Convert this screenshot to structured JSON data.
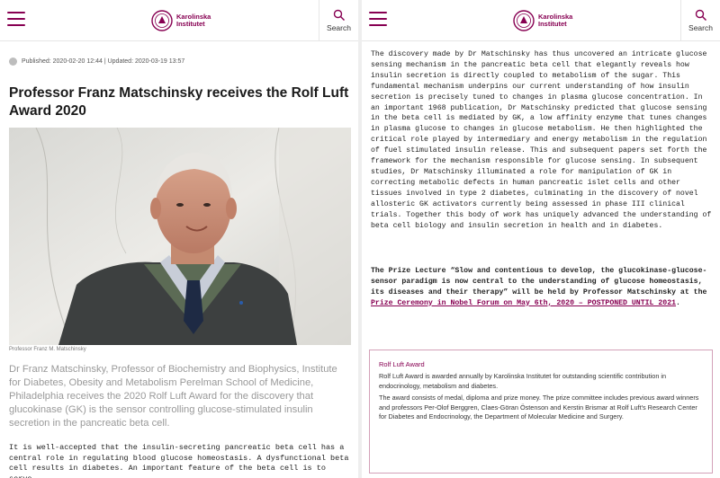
{
  "header": {
    "logo_line1": "Karolinska",
    "logo_line2": "Institutet",
    "search_label": "Search"
  },
  "article": {
    "meta": "Published: 2020-02-20 12:44 | Updated: 2020-03-19 13:57",
    "title": "Professor Franz Matschinsky receives the Rolf Luft Award 2020",
    "photo_caption": "Professor Franz M. Matschinsky",
    "lead": "Dr Franz Matschinsky, Professor of Biochemistry and Biophysics, Institute for Diabetes, Obesity and Metabolism Perelman School of Medicine, Philadelphia receives the 2020 Rolf Luft Award for the discovery that glucokinase (GK) is the sensor controlling glucose-stimulated insulin secretion in the pancreatic beta cell.",
    "body_intro": "It is well-accepted that the insulin-secreting pancreatic beta cell has a central role in regulating blood glucose homeostasis. A dysfunctional beta cell results in diabetes. An important feature of the beta cell is to serve"
  },
  "continued": {
    "body": "The discovery made by Dr Matschinsky has thus uncovered an intricate glucose sensing mechanism in the pancreatic beta cell that elegantly reveals how insulin secretion is directly coupled to metabolism of the sugar. This fundamental mechanism underpins our current understanding of how insulin secretion is precisely tuned to changes in plasma glucose concentration. In an important 1968 publication, Dr Matschinsky predicted that glucose sensing in the beta cell is mediated by GK, a low affinity enzyme that tunes changes in plasma glucose to changes in glucose metabolism. He then highlighted the critical role played by intermediary and energy metabolism in the regulation of fuel stimulated insulin release. This and subsequent papers set forth the framework for the mechanism responsible for glucose sensing. In subsequent studies, Dr Matschinsky illuminated a role for manipulation of GK in correcting metabolic defects in human pancreatic islet cells and other tissues involved in type 2 diabetes, culminating in the discovery of novel allosteric GK activators currently being assessed in phase III clinical trials. Together this body of work has uniquely advanced the understanding of beta cell biology and insulin secretion in health and in diabetes.",
    "prize_text": "The Prize Lecture “Slow and contentious to develop, the glucokinase-glucose-sensor paradigm is now central to the understanding of glucose homeostasis, its diseases and their therapy” will be held by Professor Matschinsky at the ",
    "prize_link": "Prize Ceremony in Nobel Forum on May 6th, 2020 – POSTPONED UNTIL 2021",
    "prize_end": "."
  },
  "award_box": {
    "title": "Rolf Luft Award",
    "p1": "Rolf Luft Award is awarded annually by Karolinska Institutet for outstanding scientific contribution in endocrinology, metabolism and diabetes.",
    "p2": "The award consists of medal, diploma and prize money. The prize committee includes previous award winners and professors Per-Olof Berggren, Claes-Göran Östenson and Kerstin Brismar at Rolf Luft's Research Center for Diabetes and Endocrinology, the Department of Molecular Medicine and Surgery."
  },
  "colors": {
    "brand": "#870052",
    "lead_text": "#999999"
  },
  "icons": [
    "menu-icon",
    "search-icon",
    "clock-icon",
    "ki-seal-logo"
  ]
}
